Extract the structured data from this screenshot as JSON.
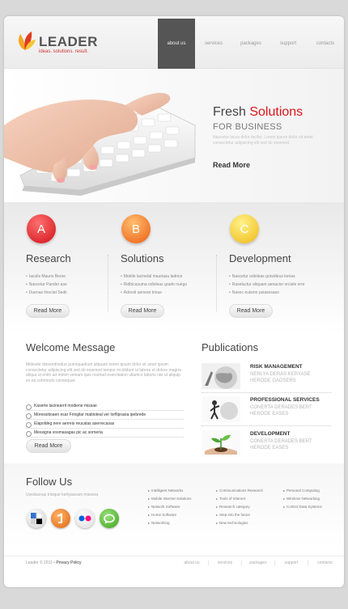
{
  "header": {
    "logo_title": "LEADER",
    "logo_tagline": "ideas. solutions. result.",
    "nav": [
      "about us",
      "services",
      "packages",
      "support",
      "contacts"
    ],
    "active_nav": "about us"
  },
  "hero": {
    "title_plain": "Fresh",
    "title_accent": "Solutions",
    "subtitle": "FOR BUSINESS",
    "body": "Nascetur lacus dolor facilisi. Lorem ipsum dolor sit amet consectetur adipiscing elit sed do eiusmod.",
    "link": "Read More"
  },
  "services": [
    {
      "letter": "A",
      "title": "Research",
      "items": [
        "Iaculis Mauris Beroe",
        "Nascetur Pander ase",
        "Duenas linoclat Sedir"
      ],
      "button": "Read More",
      "color_top": "#ff4a4a",
      "color_bottom": "#d01018"
    },
    {
      "letter": "B",
      "title": "Solutions",
      "items": [
        "Mobile lacinetal mauriasu ladrice",
        "Ridbicasuma odioleas grade nuego",
        "Adrexti aenean trixue"
      ],
      "button": "Read More",
      "color_top": "#ffa03a",
      "color_bottom": "#ec5c10"
    },
    {
      "letter": "C",
      "title": "Development",
      "items": [
        "Nascetur odioleas gravideus kerias",
        "Raseluctur aliquam aenacior orciele erre",
        "Nasec euismo psiasesaes"
      ],
      "button": "Read More",
      "color_top": "#ffe860",
      "color_bottom": "#f0b814"
    }
  ],
  "welcome": {
    "title": "Welcome Message",
    "body": "Molesite dissendrisduo puesquadium aliquam lorem ipsum dolor sit amet ipsum consectetur adipiscing elit sed do eiusmod tempor incididunt ut labore et dolore magna aliqua ut enim ad minim veniam quis nostrud exercitation ullamco laboris nisi ut aliquip ex ea commodo consequat.",
    "items": [
      "Kaserte lacinearril modiene missae",
      "Moressitioaen esar Fringilar mabioteal ver lorfliprasia ipebrede",
      "Elapoldeg nere aerreis reucalas aserrecasas",
      "Messigna vosmasagas pic ac sorneria"
    ],
    "button": "Read More"
  },
  "publications": {
    "title": "Publications",
    "items": [
      {
        "head": "RISK MANAGEMENT",
        "sub": "NERLYA DERAS KERYASE HERODE GADSERS"
      },
      {
        "head": "PROFESSIONAL SERVICES",
        "sub": "CONERTA DERADES BERT HERODE EASES"
      },
      {
        "head": "DEVELOPMENT",
        "sub": "CONERTA DERADES BERT HERODE EASES"
      }
    ]
  },
  "follow": {
    "title": "Follow Us",
    "tagline": "Useduenas trisique kertyaseam misoera",
    "social": [
      "delicious",
      "stumbleupon",
      "flickr",
      "technorati"
    ],
    "col1": [
      "Intelligent Networks",
      "Mobile Internet Solutions",
      "Network Software",
      "Home Software",
      "Networking"
    ],
    "col2": [
      "Communications Research",
      "Tools of Internet",
      "Research category",
      "Step into the future",
      "New technologies"
    ],
    "col3": [
      "Personal Computing",
      "Wireless Networking",
      "Control Data Systems"
    ]
  },
  "footer": {
    "copyright": "Leader © 2011 •",
    "privacy": "Privacy Policy",
    "nav": [
      "about us",
      "services",
      "packages",
      "support",
      "contacts"
    ]
  }
}
